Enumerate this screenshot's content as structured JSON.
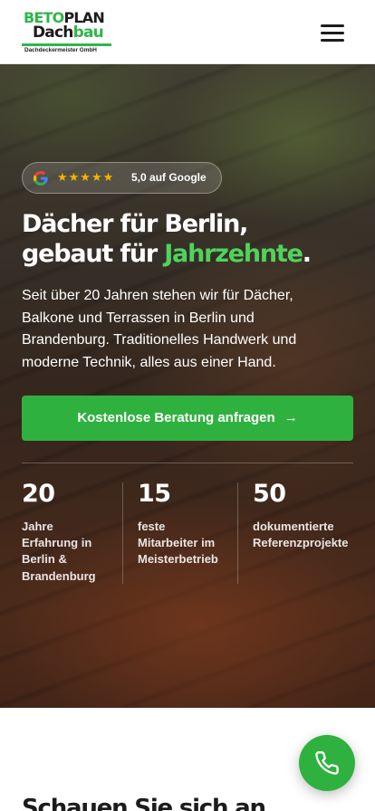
{
  "brand": {
    "logo_top_a": "BETO",
    "logo_top_b": "PLAN",
    "logo_mid_a": "Dach",
    "logo_mid_b": "bau",
    "logo_sub": "Dachdeckermeister GmbH",
    "accent_color": "#2fb13f"
  },
  "nav": {
    "menu_icon": "hamburger-menu-icon"
  },
  "hero": {
    "rating": {
      "icon": "google-icon",
      "stars": "★★★★★",
      "label": "5,0 auf Google"
    },
    "headline_line1": "Dächer für Berlin,",
    "headline_line2_pre": "gebaut für ",
    "headline_accent": "Jahrzehnte",
    "headline_end": ".",
    "lead": "Seit über 20 Jahren stehen wir für Dächer, Balkone und Terrassen in Berlin und Brandenburg. Traditionelles Handwerk und moderne Technik, alles aus einer Hand.",
    "cta_label": "Kostenlose Beratung anfragen",
    "cta_icon": "arrow-right-icon",
    "stats": [
      {
        "value": "20",
        "label": "Jahre Erfahrung in Berlin & Brandenburg"
      },
      {
        "value": "15",
        "label": "feste Mitarbeiter im Meisterbetrieb"
      },
      {
        "value": "50",
        "label": "dokumentierte Referenzprojekte"
      }
    ]
  },
  "next_section": {
    "heading": "Schauen Sie sich an"
  },
  "floating": {
    "call_icon": "phone-icon"
  }
}
